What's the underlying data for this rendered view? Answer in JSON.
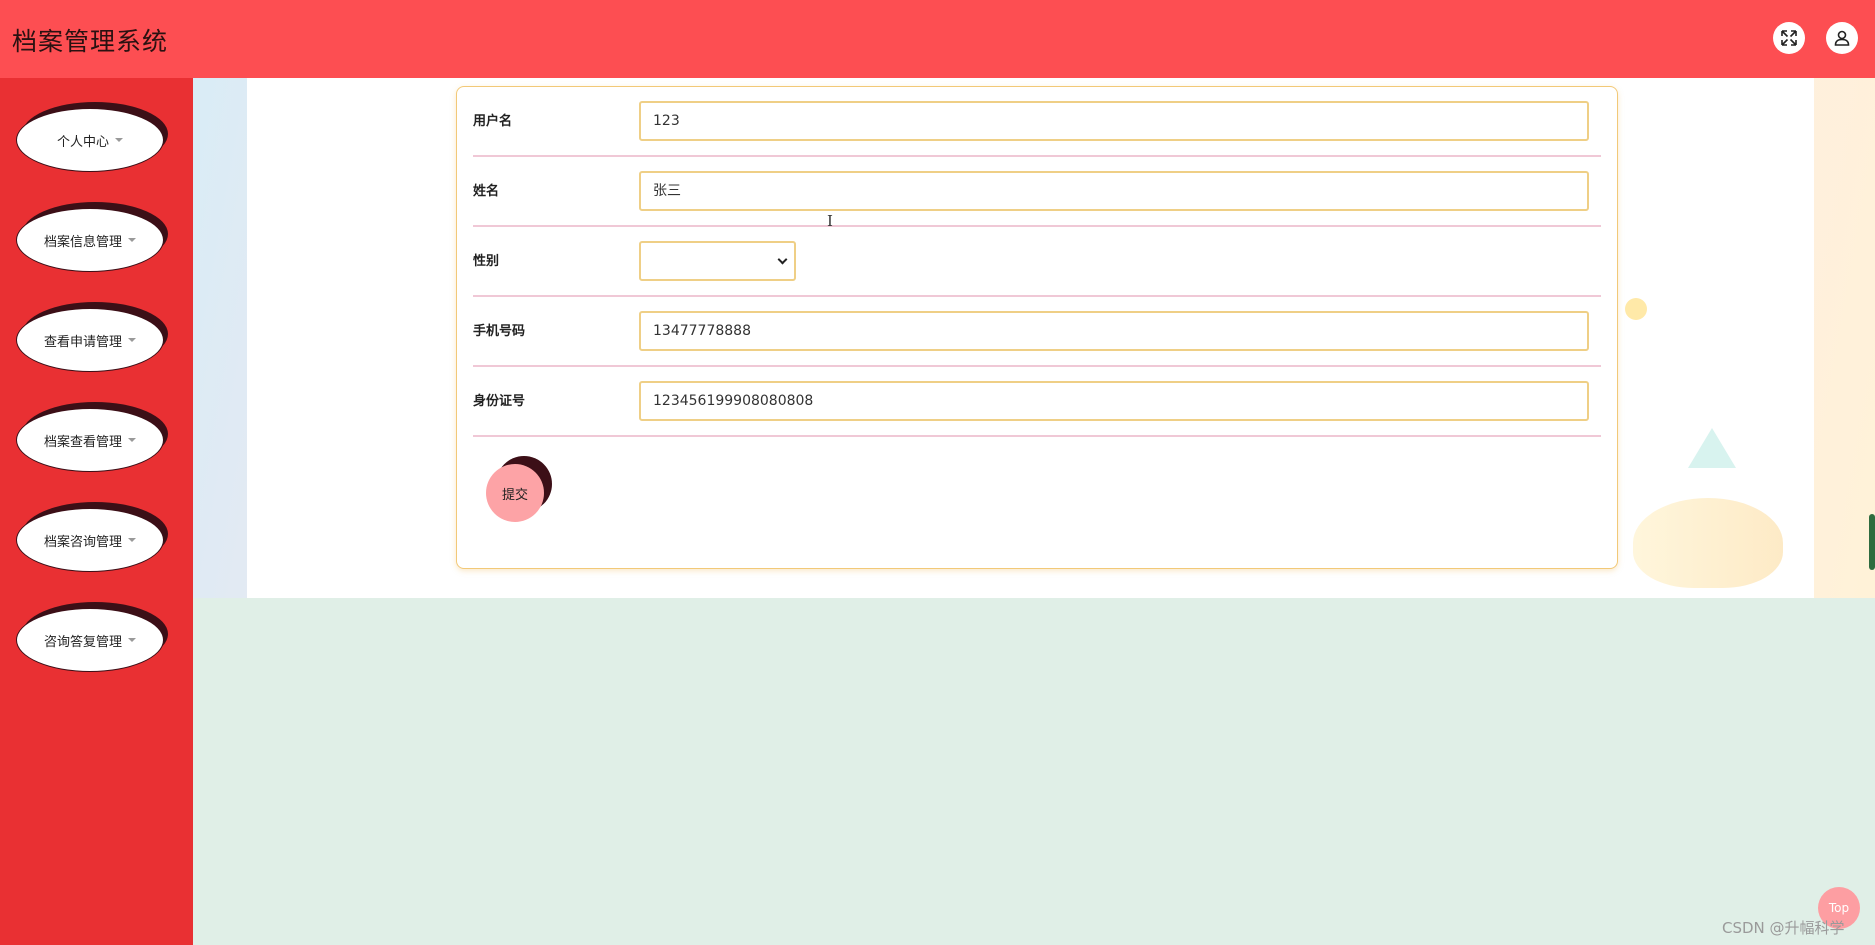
{
  "header": {
    "title": "档案管理系统",
    "fullscreen_icon": "expand-arrows-icon",
    "user_icon": "user-icon"
  },
  "sidebar": {
    "items": [
      {
        "label": "个人中心"
      },
      {
        "label": "档案信息管理"
      },
      {
        "label": "查看申请管理"
      },
      {
        "label": "档案查看管理"
      },
      {
        "label": "档案咨询管理"
      },
      {
        "label": "咨询答复管理"
      }
    ]
  },
  "form": {
    "fields": [
      {
        "label": "用户名",
        "value": "123"
      },
      {
        "label": "姓名",
        "value": "张三"
      },
      {
        "label": "性别",
        "value": ""
      },
      {
        "label": "手机号码",
        "value": "13477778888"
      },
      {
        "label": "身份证号",
        "value": "123456199908080808"
      }
    ],
    "submit_label": "提交"
  },
  "footer": {
    "top_label": "Top",
    "watermark": "CSDN @升幅科学"
  },
  "colors": {
    "header": "#fd4e52",
    "sidebar": "#e93033",
    "accent_border": "#efcf86",
    "submit": "#fda3a6"
  }
}
